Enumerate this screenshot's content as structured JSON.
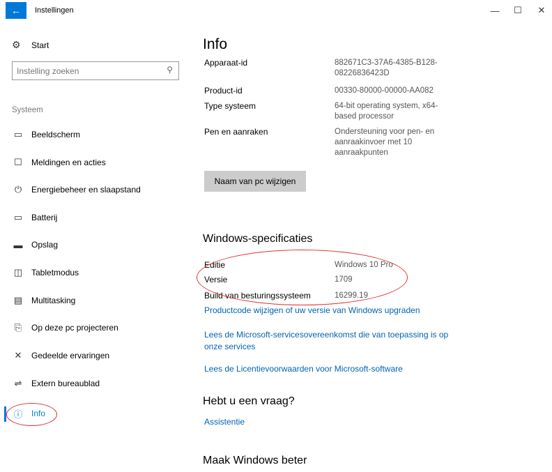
{
  "window": {
    "title": "Instellingen",
    "back_icon": "arrow-left-icon",
    "controls": [
      "minimize",
      "maximize",
      "close"
    ]
  },
  "sidebar": {
    "start_label": "Start",
    "search_placeholder": "Instelling zoeken",
    "section": "Systeem",
    "items": [
      {
        "label": "Beeldscherm",
        "icon": "monitor-icon"
      },
      {
        "label": "Meldingen en acties",
        "icon": "notification-icon"
      },
      {
        "label": "Energiebeheer en slaapstand",
        "icon": "power-icon"
      },
      {
        "label": "Batterij",
        "icon": "battery-icon"
      },
      {
        "label": "Opslag",
        "icon": "storage-icon"
      },
      {
        "label": "Tabletmodus",
        "icon": "tablet-mode-icon"
      },
      {
        "label": "Multitasking",
        "icon": "multitasking-icon"
      },
      {
        "label": "Op deze pc projecteren",
        "icon": "project-icon"
      },
      {
        "label": "Gedeelde ervaringen",
        "icon": "shared-experiences-icon"
      },
      {
        "label": "Extern bureaublad",
        "icon": "remote-desktop-icon"
      },
      {
        "label": "Info",
        "icon": "info-icon",
        "active": true
      }
    ]
  },
  "main": {
    "title": "Info",
    "device": {
      "device_id_label": "Apparaat-id",
      "device_id_value": "882671C3-37A6-4385-B128-08226836423D",
      "product_id_label": "Product-id",
      "product_id_value": "00330-80000-00000-AA082",
      "system_type_label": "Type systeem",
      "system_type_value": "64-bit operating system, x64-based processor",
      "pen_label": "Pen en aanraken",
      "pen_value": "Ondersteuning voor pen- en aanraakinvoer met 10 aanraakpunten"
    },
    "rename_button": "Naam van pc wijzigen",
    "windows_specs": {
      "heading": "Windows-specificaties",
      "edition_label": "Editie",
      "edition_value": "Windows 10 Pro",
      "version_label": "Versie",
      "version_value": "1709",
      "build_label": "Build van besturingssysteem",
      "build_value": "16299.19"
    },
    "links": [
      "Productcode wijzigen of uw versie van Windows upgraden",
      "Lees de Microsoft-servicesovereenkomst die van toepassing is op onze services",
      "Lees de Licentievoorwaarden voor Microsoft-software"
    ],
    "question_heading": "Hebt u een vraag?",
    "assist_link": "Assistentie",
    "improve_heading": "Maak Windows beter"
  },
  "colors": {
    "accent": "#0078d7",
    "link": "#0063b1",
    "annotation": "#e0312e"
  }
}
